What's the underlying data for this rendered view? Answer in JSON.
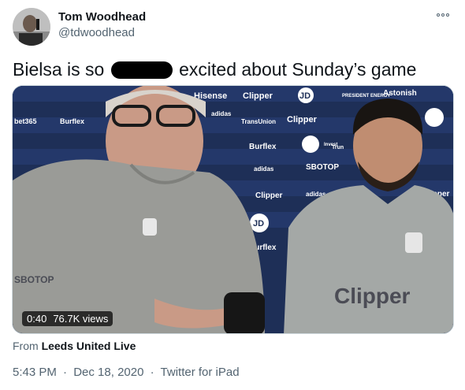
{
  "author": {
    "name": "Tom Woodhead",
    "handle": "@tdwoodhead"
  },
  "tweet": {
    "text_before": "Bielsa is so",
    "text_after": "excited about Sunday’s game"
  },
  "media": {
    "time": "0:40",
    "views": "76.7K views",
    "sponsor_words": [
      "Hisense",
      "Clipper",
      "JD",
      "PRESIDENT ENERGY",
      "Astonish",
      "bet365",
      "Burflex",
      "TransUnion",
      "SBOTOP",
      "adidas",
      "Invest",
      "Trun",
      "Clipper"
    ]
  },
  "source": {
    "prefix": "From",
    "name": "Leeds United Live"
  },
  "meta": {
    "time": "5:43 PM",
    "sep1": "·",
    "date": "Dec 18, 2020",
    "sep2": "·",
    "client": "Twitter for iPad"
  }
}
